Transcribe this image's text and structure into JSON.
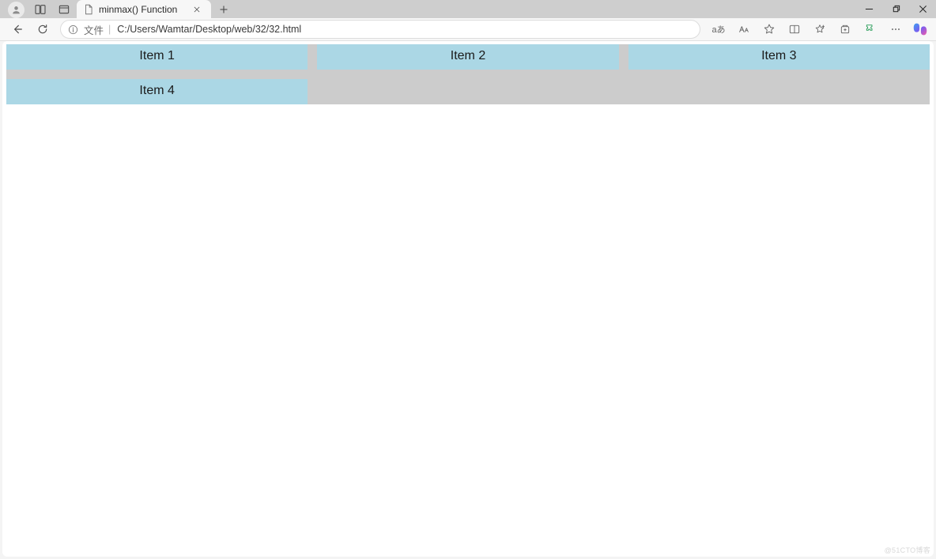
{
  "browser": {
    "tab_title": "minmax() Function",
    "address_label": "文件",
    "address_path": "C:/Users/Wamtar/Desktop/web/32/32.html",
    "translate_label": "aあ"
  },
  "page": {
    "grid_items": [
      "Item 1",
      "Item 2",
      "Item 3",
      "Item 4"
    ]
  },
  "watermark": "@51CTO博客"
}
